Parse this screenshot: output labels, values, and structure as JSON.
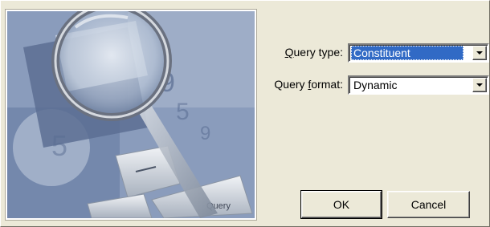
{
  "dialog": {
    "picture_caption": "Query",
    "query_type": {
      "label_access": "Q",
      "label_rest": "uery type:",
      "value": "Constituent"
    },
    "query_format": {
      "label_start": "Query ",
      "label_access": "f",
      "label_rest": "ormat:",
      "value": "Dynamic"
    },
    "buttons": {
      "ok": "OK",
      "cancel": "Cancel"
    },
    "icons": {
      "dropdown": "chevron-down-icon",
      "illustration": "magnifying-glass-keyboard-illustration"
    },
    "colors": {
      "selection": "#316ac5",
      "face": "#ece9d8"
    }
  }
}
